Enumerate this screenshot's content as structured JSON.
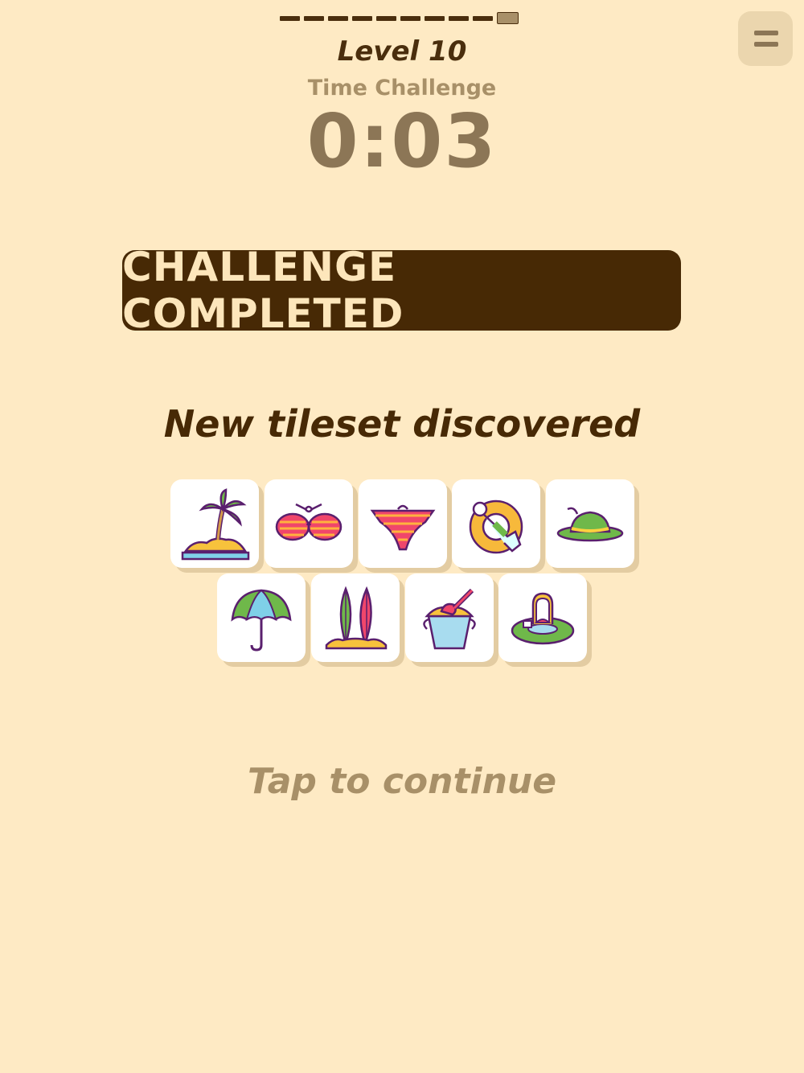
{
  "header": {
    "level_title": "Level 10",
    "mode_label": "Time Challenge",
    "timer": "0:03",
    "progress": {
      "segments": 10,
      "current": 10
    }
  },
  "menu_icon": "hamburger-menu-icon",
  "banner": {
    "text": "CHALLENGE COMPLETED"
  },
  "tileset": {
    "heading": "New tileset discovered",
    "tiles": [
      {
        "icon": "palm-island-icon"
      },
      {
        "icon": "bikini-top-icon"
      },
      {
        "icon": "bikini-bottom-icon"
      },
      {
        "icon": "swim-ring-person-icon"
      },
      {
        "icon": "sun-hat-icon"
      },
      {
        "icon": "beach-umbrella-icon"
      },
      {
        "icon": "surfboards-icon"
      },
      {
        "icon": "sand-bucket-icon"
      },
      {
        "icon": "floating-tube-girl-icon"
      }
    ]
  },
  "footer": {
    "tap_text": "Tap to continue"
  },
  "colors": {
    "background": "#feeac4",
    "dark_brown": "#472905",
    "muted_brown": "#a89068"
  }
}
